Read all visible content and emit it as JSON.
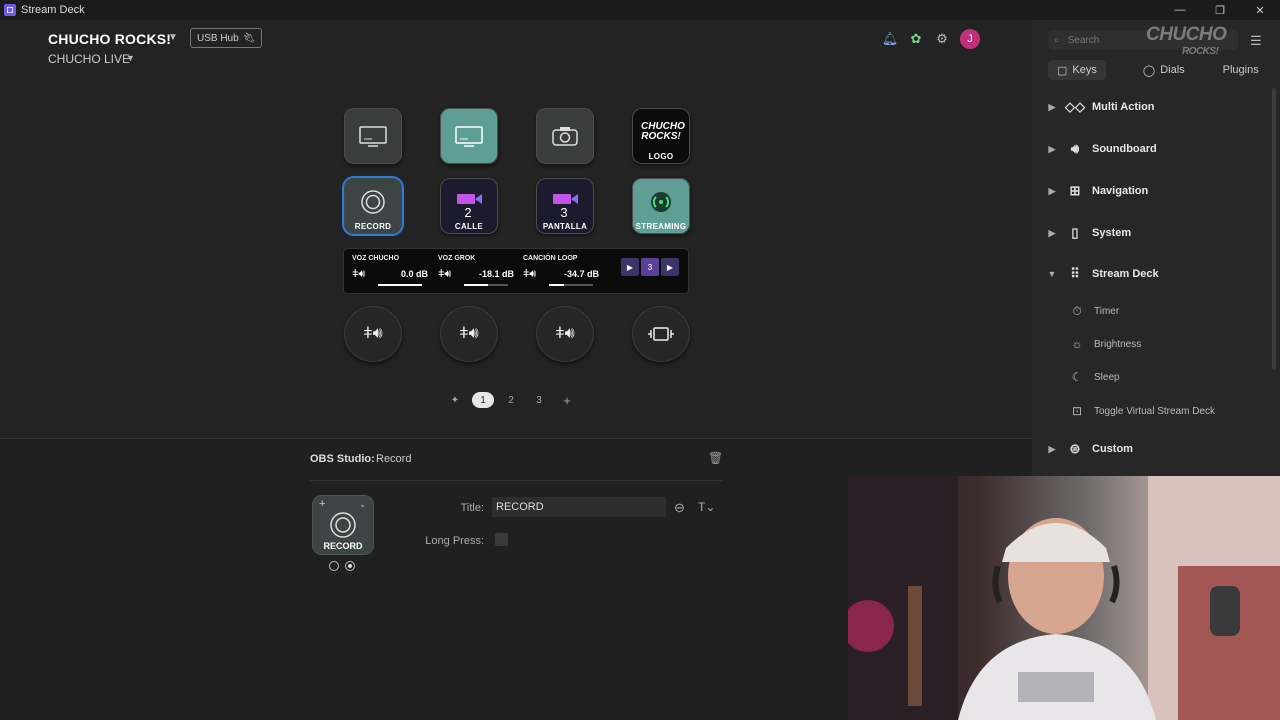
{
  "window": {
    "title": "Stream Deck",
    "controls": [
      "—",
      "❐",
      "✕"
    ]
  },
  "header": {
    "profile_name": "CHUCHO ROCKS!",
    "device": "USB Hub",
    "page_name": "CHUCHO LIVE"
  },
  "keys": [
    {
      "label": "",
      "icon": "screen-icon"
    },
    {
      "label": "",
      "icon": "screen-icon"
    },
    {
      "label": "",
      "icon": "camera-icon"
    },
    {
      "label": "LOGO",
      "icon": "chucho-rocks-logo",
      "logo_text": "CHUCHO ROCKS!"
    },
    {
      "label": "RECORD",
      "icon": "record-icon"
    },
    {
      "label": "CALLE",
      "icon": "video-camera-icon",
      "number": "2"
    },
    {
      "label": "PANTALLA",
      "icon": "video-camera-icon",
      "number": "3"
    },
    {
      "label": "STREAMING",
      "icon": "broadcast-icon"
    }
  ],
  "lcd": [
    {
      "name": "VOZ CHUCHO",
      "value": "0.0 dB",
      "level": 1.0
    },
    {
      "name": "VOZ GROK",
      "value": "-18.1 dB",
      "level": 0.55
    },
    {
      "name": "CANCIÓN LOOP",
      "value": "-34.7 dB",
      "level": 0.35
    }
  ],
  "lcd_thumb_number": "3",
  "pages": {
    "pin_icon": "pin-icon",
    "items": [
      "1",
      "2",
      "3"
    ],
    "active": "1",
    "add_label": "+"
  },
  "inspector": {
    "plugin": "OBS Studio:",
    "action": "Record",
    "key_label": "RECORD",
    "title_label": "Title:",
    "title_value": "RECORD",
    "long_press_label": "Long Press:"
  },
  "sidebar": {
    "search_placeholder": "Search",
    "tabs": [
      "Keys",
      "Dials",
      "Plugins"
    ],
    "categories": [
      {
        "label": "Multi Action",
        "icon": "multi-action-icon",
        "expanded": false
      },
      {
        "label": "Soundboard",
        "icon": "speaker-icon",
        "expanded": false
      },
      {
        "label": "Navigation",
        "icon": "navigation-icon",
        "expanded": false
      },
      {
        "label": "System",
        "icon": "system-icon",
        "expanded": false
      },
      {
        "label": "Stream Deck",
        "icon": "stream-deck-icon",
        "expanded": true
      },
      {
        "label": "Custom",
        "icon": "custom-icon",
        "expanded": false
      }
    ],
    "stream_deck_items": [
      {
        "label": "Timer",
        "icon": "timer-icon"
      },
      {
        "label": "Brightness",
        "icon": "brightness-icon"
      },
      {
        "label": "Sleep",
        "icon": "sleep-icon"
      },
      {
        "label": "Toggle Virtual Stream Deck",
        "icon": "toggle-virtual-icon"
      }
    ]
  },
  "watermark": {
    "line1": "CHUCHO",
    "line2": "ROCKS!"
  },
  "colors": {
    "accent": "#2f7bdc",
    "avatar": "#c2307b",
    "teal_key": "#5f9e94",
    "background": "#232323"
  }
}
